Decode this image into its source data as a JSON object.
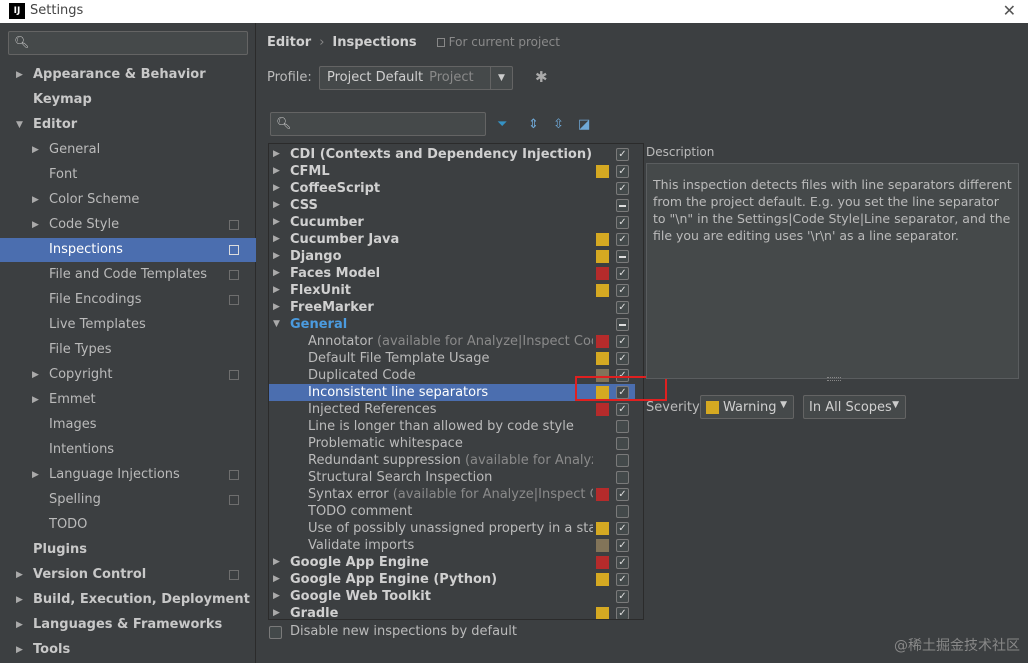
{
  "window": {
    "title": "Settings",
    "logo": "IJ",
    "close_icon": "✕"
  },
  "colors": {
    "selection": "#4b6eaf",
    "warning": "#d5a922",
    "error": "#b52b2b",
    "weak_warning": "#827459",
    "active_group": "#4b9bdf"
  },
  "sidebar": {
    "items": [
      {
        "label": "Appearance & Behavior",
        "level": 0,
        "arrow": "▶",
        "bold": true
      },
      {
        "label": "Keymap",
        "level": 0,
        "arrow": "",
        "bold": true
      },
      {
        "label": "Editor",
        "level": 0,
        "arrow": "▼",
        "bold": true
      },
      {
        "label": "General",
        "level": 1,
        "arrow": "▶"
      },
      {
        "label": "Font",
        "level": 1,
        "arrow": ""
      },
      {
        "label": "Color Scheme",
        "level": 1,
        "arrow": "▶"
      },
      {
        "label": "Code Style",
        "level": 1,
        "arrow": "▶",
        "project": true
      },
      {
        "label": "Inspections",
        "level": 1,
        "arrow": "",
        "project": true,
        "selected": true
      },
      {
        "label": "File and Code Templates",
        "level": 1,
        "arrow": "",
        "project": true
      },
      {
        "label": "File Encodings",
        "level": 1,
        "arrow": "",
        "project": true
      },
      {
        "label": "Live Templates",
        "level": 1,
        "arrow": ""
      },
      {
        "label": "File Types",
        "level": 1,
        "arrow": ""
      },
      {
        "label": "Copyright",
        "level": 1,
        "arrow": "▶",
        "project": true
      },
      {
        "label": "Emmet",
        "level": 1,
        "arrow": "▶"
      },
      {
        "label": "Images",
        "level": 1,
        "arrow": ""
      },
      {
        "label": "Intentions",
        "level": 1,
        "arrow": ""
      },
      {
        "label": "Language Injections",
        "level": 1,
        "arrow": "▶",
        "project": true
      },
      {
        "label": "Spelling",
        "level": 1,
        "arrow": "",
        "project": true
      },
      {
        "label": "TODO",
        "level": 1,
        "arrow": ""
      },
      {
        "label": "Plugins",
        "level": 0,
        "arrow": "",
        "bold": true
      },
      {
        "label": "Version Control",
        "level": 0,
        "arrow": "▶",
        "bold": true,
        "project": true
      },
      {
        "label": "Build, Execution, Deployment",
        "level": 0,
        "arrow": "▶",
        "bold": true
      },
      {
        "label": "Languages & Frameworks",
        "level": 0,
        "arrow": "▶",
        "bold": true
      },
      {
        "label": "Tools",
        "level": 0,
        "arrow": "▶",
        "bold": true
      }
    ]
  },
  "breadcrumb": {
    "editor": "Editor",
    "sep": "›",
    "current": "Inspections",
    "scope_note": "For current project"
  },
  "profile": {
    "label": "Profile:",
    "value": "Project Default",
    "qualifier": "Project",
    "dropdown_icon": "▼",
    "gear_icon": "✱"
  },
  "toolbar": {
    "filter_icon": "⏷",
    "expand_icon": "⇕",
    "collapse_icon": "⇳",
    "reset_icon": "◪"
  },
  "inspections": [
    {
      "label": "CDI (Contexts and Dependency Injection)",
      "type": "group",
      "arrow": "▶",
      "sev": "",
      "check": "✓"
    },
    {
      "label": "CFML",
      "type": "group",
      "arrow": "▶",
      "sev": "warning",
      "check": "✓"
    },
    {
      "label": "CoffeeScript",
      "type": "group",
      "arrow": "▶",
      "sev": "",
      "check": "✓"
    },
    {
      "label": "CSS",
      "type": "group",
      "arrow": "▶",
      "sev": "",
      "check": "dash"
    },
    {
      "label": "Cucumber",
      "type": "group",
      "arrow": "▶",
      "sev": "",
      "check": "✓"
    },
    {
      "label": "Cucumber Java",
      "type": "group",
      "arrow": "▶",
      "sev": "warning",
      "check": "✓"
    },
    {
      "label": "Django",
      "type": "group",
      "arrow": "▶",
      "sev": "warning",
      "check": "dash"
    },
    {
      "label": "Faces Model",
      "type": "group",
      "arrow": "▶",
      "sev": "error",
      "check": "✓"
    },
    {
      "label": "FlexUnit",
      "type": "group",
      "arrow": "▶",
      "sev": "warning",
      "check": "✓"
    },
    {
      "label": "FreeMarker",
      "type": "group",
      "arrow": "▶",
      "sev": "",
      "check": "✓"
    },
    {
      "label": "General",
      "type": "group",
      "arrow": "▼",
      "sev": "",
      "check": "dash",
      "active": true
    },
    {
      "label": "Annotator",
      "extra": "(available for Analyze|Inspect Code)",
      "type": "child",
      "sev": "error",
      "check": "✓"
    },
    {
      "label": "Default File Template Usage",
      "type": "child",
      "sev": "warning",
      "check": "✓"
    },
    {
      "label": "Duplicated Code",
      "type": "child",
      "sev": "weak",
      "check": "✓"
    },
    {
      "label": "Inconsistent line separators",
      "type": "child",
      "sev": "warning",
      "check": "✓",
      "selected": true
    },
    {
      "label": "Injected References",
      "type": "child",
      "sev": "error",
      "check": "✓"
    },
    {
      "label": "Line is longer than allowed by code style",
      "type": "child",
      "sev": "",
      "check": ""
    },
    {
      "label": "Problematic whitespace",
      "type": "child",
      "sev": "",
      "check": ""
    },
    {
      "label": "Redundant suppression",
      "extra": "(available for Analyze|Ins",
      "type": "child",
      "sev": "",
      "check": ""
    },
    {
      "label": "Structural Search Inspection",
      "type": "child",
      "sev": "",
      "check": ""
    },
    {
      "label": "Syntax error",
      "extra": "(available for Analyze|Inspect Code)",
      "type": "child",
      "sev": "error",
      "check": "✓"
    },
    {
      "label": "TODO comment",
      "type": "child",
      "sev": "",
      "check": ""
    },
    {
      "label": "Use of possibly unassigned property in a static in",
      "type": "child",
      "sev": "warning",
      "check": "✓"
    },
    {
      "label": "Validate imports",
      "type": "child",
      "sev": "weak",
      "check": "✓"
    },
    {
      "label": "Google App Engine",
      "type": "group",
      "arrow": "▶",
      "sev": "error",
      "check": "✓"
    },
    {
      "label": "Google App Engine (Python)",
      "type": "group",
      "arrow": "▶",
      "sev": "warning",
      "check": "✓"
    },
    {
      "label": "Google Web Toolkit",
      "type": "group",
      "arrow": "▶",
      "sev": "",
      "check": "✓"
    },
    {
      "label": "Gradle",
      "type": "group",
      "arrow": "▶",
      "sev": "warning",
      "check": "✓"
    }
  ],
  "disable_new": {
    "label": "Disable new inspections by default"
  },
  "description": {
    "label": "Description",
    "text": "This inspection detects files with line separators different from the project default. E.g. you set the line separator to \"\\n\" in the Settings|Code Style|Line separator, and the file you are editing uses '\\r\\n' as a line separator."
  },
  "severity": {
    "label": "Severity:",
    "value": "Warning",
    "scope": "In All Scopes",
    "dropdown_icon": "▼"
  },
  "watermark": "@稀土掘金技术社区"
}
